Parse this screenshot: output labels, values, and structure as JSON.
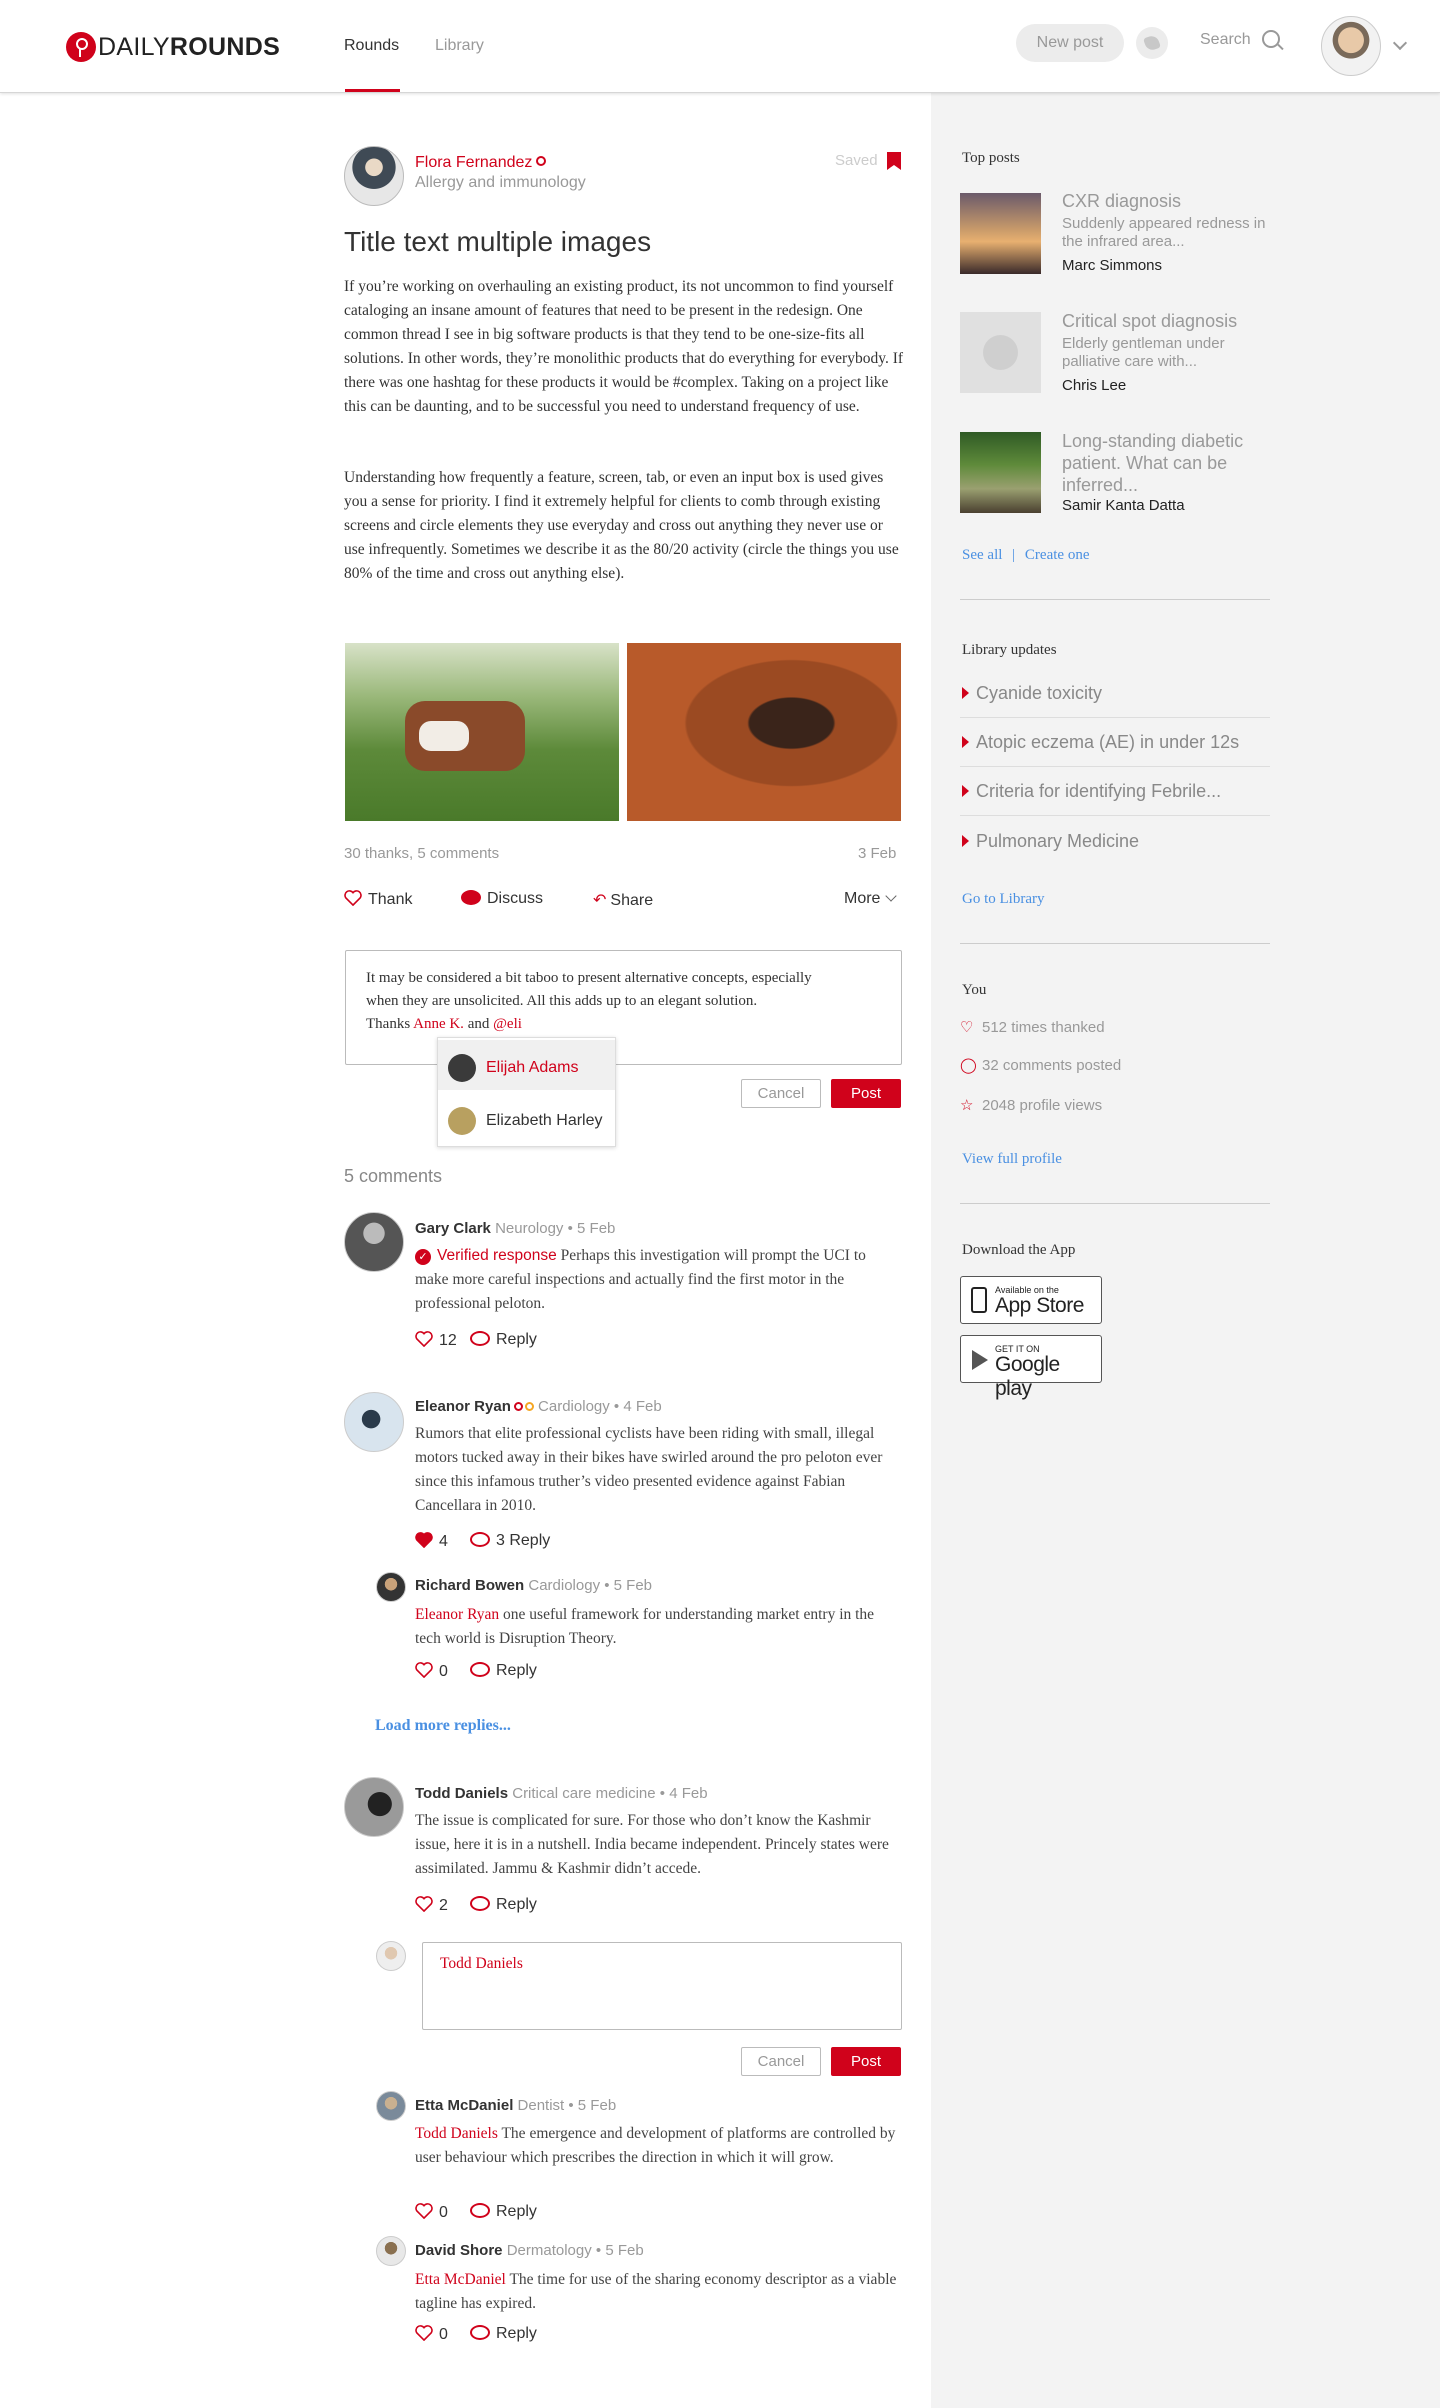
{
  "header": {
    "logo_light": "DAILY",
    "logo_bold": "ROUNDS",
    "tabs": [
      "Rounds",
      "Library"
    ],
    "new_post": "New post",
    "search": "Search"
  },
  "post": {
    "author": "Flora Fernandez",
    "specialty": "Allergy and immunology",
    "saved": "Saved",
    "title": "Title text multiple images",
    "paragraphs": [
      "If you’re working on overhauling an existing product, its not uncommon to find yourself cataloging an insane amount of features that need to be present in the redesign. One common thread I see in big software products is that they tend to be one-size-fits all solutions. In other words, they’re monolithic products that do everything for everybody. If there was one hashtag for these products it would be #complex. Taking on a project like this can be daunting, and to be successful you need to understand frequency of use.",
      "Understanding how frequently a feature, screen, tab, or even an input box is used gives you a sense for priority. I find it extremely helpful for clients to comb through existing screens and circle elements they use everyday and cross out anything they never use or use infrequently. Sometimes we describe it as the 80/20 activity (circle the things you use 80% of the time and cross out anything else)."
    ],
    "stats": "30 thanks, 5 comments",
    "date": "3 Feb",
    "actions": {
      "thank": "Thank",
      "discuss": "Discuss",
      "share": "Share",
      "more": "More"
    }
  },
  "composer": {
    "line1": "It may be considered a bit taboo to present alternative concepts, especially",
    "line2": "when they are unsolicited. All this adds up to an elegant solution.",
    "thanks": "Thanks",
    "mention1": "Anne K.",
    "and": "and",
    "mention2": "@eli",
    "suggestions": [
      "Elijah Adams",
      "Elizabeth Harley"
    ],
    "cancel": "Cancel",
    "post": "Post"
  },
  "comments_count": "5 comments",
  "comments": [
    {
      "name": "Gary Clark",
      "meta": "Neurology • 5 Feb",
      "verified": "Verified response",
      "body": "Perhaps this investigation will prompt the UCI to make more careful inspections and actually find the first motor in the professional peloton.",
      "likes": "12",
      "reply": "Reply"
    },
    {
      "name": "Eleanor Ryan",
      "meta": "Cardiology • 4 Feb",
      "body": "Rumors that elite professional cyclists have been riding with small, illegal motors tucked away in their bikes have swirled around the pro peloton ever since this infamous truther’s video presented evidence against Fabian Cancellara in 2010.",
      "likes": "4",
      "reply": "3 Reply"
    },
    {
      "name": "Richard Bowen",
      "meta": "Cardiology • 5 Feb",
      "mention": "Eleanor Ryan",
      "body": "one useful framework for understanding market entry in the tech world is Disruption Theory.",
      "likes": "0",
      "reply": "Reply"
    },
    {
      "name": "Todd Daniels",
      "meta": "Critical care medicine • 4 Feb",
      "body": "The issue is complicated for sure. For those who don’t know the Kashmir issue, here it is in a nutshell. India became independent. Princely states were assimilated. Jammu & Kashmir didn’t accede.",
      "likes": "2",
      "reply": "Reply"
    },
    {
      "name": "Etta McDaniel",
      "meta": "Dentist • 5 Feb",
      "mention": "Todd Daniels",
      "body": "The emergence and development of platforms are controlled by user behaviour which prescribes the direction in which it will grow.",
      "likes": "0",
      "reply": "Reply"
    },
    {
      "name": "David Shore",
      "meta": "Dermatology • 5 Feb",
      "mention": "Etta McDaniel",
      "body": "The time for use of the sharing economy descriptor as a viable tagline has expired.",
      "likes": "0",
      "reply": "Reply"
    }
  ],
  "load_more": "Load more replies...",
  "reply_box": {
    "mention": "Todd Daniels",
    "cancel": "Cancel",
    "post": "Post"
  },
  "sidebar": {
    "top_posts_heading": "Top posts",
    "top_posts": [
      {
        "title": "CXR diagnosis",
        "sub": "Suddenly appeared redness in the infrared area...",
        "author": "Marc Simmons"
      },
      {
        "title": "Critical spot diagnosis",
        "sub": "Elderly gentleman under palliative care with...",
        "author": "Chris Lee"
      },
      {
        "title": "Long-standing diabetic patient. What can be inferred...",
        "sub": "",
        "author": "Samir Kanta Datta"
      }
    ],
    "see_all": "See all",
    "sep": "|",
    "create_one": "Create one",
    "library_heading": "Library updates",
    "library": [
      "Cyanide toxicity",
      "Atopic eczema (AE) in under 12s",
      "Criteria for identifying Febrile...",
      "Pulmonary Medicine"
    ],
    "go_library": "Go to Library",
    "you_heading": "You",
    "you": [
      "512 times thanked",
      "32 comments posted",
      "2048 profile views"
    ],
    "view_profile": "View full profile",
    "download_heading": "Download the App",
    "appstore_small": "Available on the",
    "appstore_big": "App Store",
    "gplay_small": "GET IT ON",
    "gplay_big": "Google play"
  },
  "colors": {
    "brand": "#d0021b",
    "link": "#4a90e2",
    "sidebar_bg": "#f3f3f3"
  }
}
